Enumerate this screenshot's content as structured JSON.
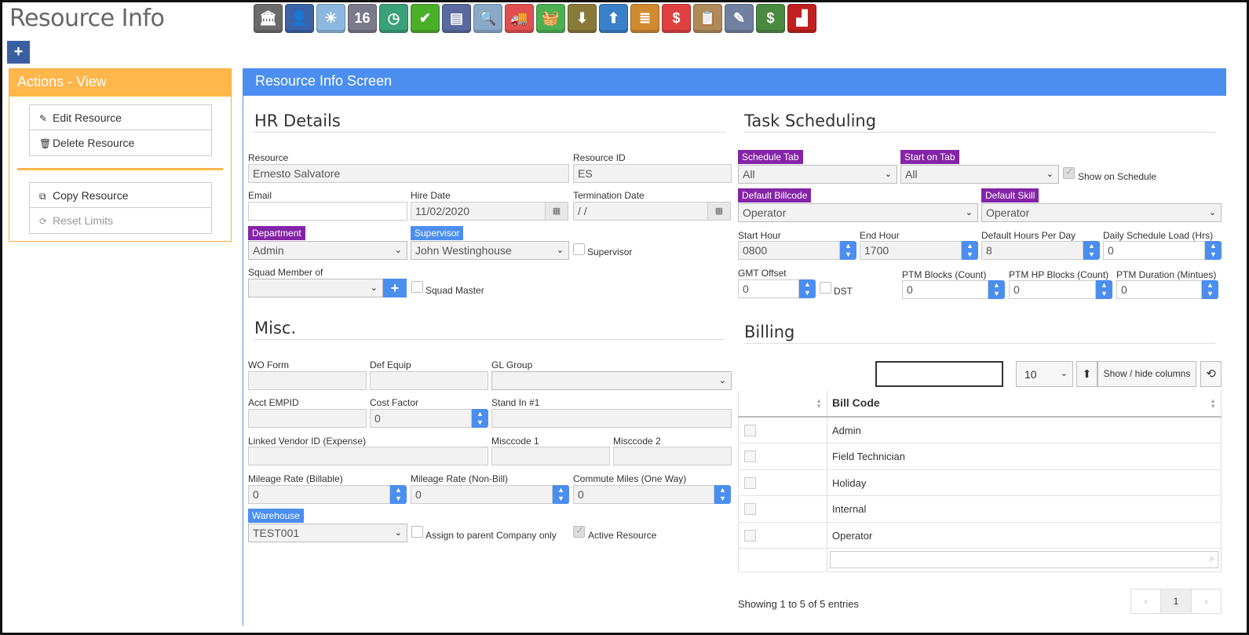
{
  "page": {
    "title": "Resource Info"
  },
  "toolbar": [
    {
      "icon": "bank-icon",
      "glyph": "🏛",
      "color": "#6b6b6b"
    },
    {
      "icon": "user-icon",
      "glyph": "👤",
      "color": "#3a63a8"
    },
    {
      "icon": "weather-icon",
      "glyph": "☀",
      "color": "#8cb8e0"
    },
    {
      "icon": "calendar-icon",
      "glyph": "16",
      "color": "#7a7a8a"
    },
    {
      "icon": "clock-icon",
      "glyph": "◷",
      "color": "#3aa07a"
    },
    {
      "icon": "checkmark-icon",
      "glyph": "✔",
      "color": "#4caf2a"
    },
    {
      "icon": "schedule-board-icon",
      "glyph": "▤",
      "color": "#5a6aa0"
    },
    {
      "icon": "magnifier-icon",
      "glyph": "🔍",
      "color": "#8aa8c8"
    },
    {
      "icon": "truck-icon",
      "glyph": "🚚",
      "color": "#e05050"
    },
    {
      "icon": "basket-icon",
      "glyph": "🧺",
      "color": "#4caf50"
    },
    {
      "icon": "inbox-download-icon",
      "glyph": "⬇",
      "color": "#8a7a3a"
    },
    {
      "icon": "outbox-upload-icon",
      "glyph": "⬆",
      "color": "#3a80c8"
    },
    {
      "icon": "stack-icon",
      "glyph": "≣",
      "color": "#d08a30"
    },
    {
      "icon": "money-chat-icon",
      "glyph": "$",
      "color": "#e04040"
    },
    {
      "icon": "clipboard-icon",
      "glyph": "📋",
      "color": "#b08a5a"
    },
    {
      "icon": "pencil-note-icon",
      "glyph": "✎",
      "color": "#7080a0"
    },
    {
      "icon": "cash-icon",
      "glyph": "$",
      "color": "#4a8a40"
    },
    {
      "icon": "factory-icon",
      "glyph": "▟",
      "color": "#c02020"
    }
  ],
  "actions": {
    "title": "Actions - View",
    "group1": [
      {
        "icon": "pencil-icon",
        "glyph": "✎",
        "label": "Edit Resource"
      },
      {
        "icon": "trash-icon",
        "glyph": "🗑",
        "label": "Delete Resource"
      }
    ],
    "group2": [
      {
        "icon": "copy-icon",
        "glyph": "⧉",
        "label": "Copy Resource"
      },
      {
        "icon": "refresh-icon",
        "glyph": "⟳",
        "label": "Reset Limits"
      }
    ]
  },
  "main": {
    "title": "Resource Info Screen"
  },
  "hr": {
    "title": "HR Details",
    "resource_label": "Resource",
    "resource_value": "Ernesto Salvatore",
    "resource_id_label": "Resource ID",
    "resource_id_value": "ES",
    "email_label": "Email",
    "email_value": "",
    "hire_date_label": "Hire Date",
    "hire_date_value": "11/02/2020",
    "termination_label": "Termination Date",
    "termination_value": " /  /",
    "department_label": "Department",
    "department_value": "Admin",
    "supervisor_label": "Supervisor",
    "supervisor_value": "John Westinghouse",
    "supervisor_check_label": "Supervisor",
    "squad_label": "Squad Member of",
    "squad_value": "",
    "squad_master_label": "Squad Master"
  },
  "misc": {
    "title": "Misc.",
    "wo_form_label": "WO Form",
    "def_equip_label": "Def Equip",
    "gl_group_label": "GL Group",
    "acct_empid_label": "Acct EMPID",
    "cost_factor_label": "Cost Factor",
    "cost_factor_value": "0",
    "stand_in_label": "Stand In #1",
    "linked_vendor_label": "Linked Vendor ID (Expense)",
    "misccode1_label": "Misccode 1",
    "misccode2_label": "Misccode 2",
    "mileage_billable_label": "Mileage Rate (Billable)",
    "mileage_billable_value": "0",
    "mileage_nonbill_label": "Mileage Rate (Non-Bill)",
    "mileage_nonbill_value": "0",
    "commute_label": "Commute Miles (One Way)",
    "commute_value": "0",
    "warehouse_label": "Warehouse",
    "warehouse_value": "TEST001",
    "assign_parent_label": "Assign to parent Company only",
    "active_resource_label": "Active Resource"
  },
  "task": {
    "title": "Task Scheduling",
    "schedule_tab_label": "Schedule Tab",
    "schedule_tab_value": "All",
    "start_tab_label": "Start on Tab",
    "start_tab_value": "All",
    "show_on_schedule_label": "Show on Schedule",
    "default_billcode_label": "Default Billcode",
    "default_billcode_value": "Operator",
    "default_skill_label": "Default Skill",
    "default_skill_value": "Operator",
    "start_hour_label": "Start Hour",
    "start_hour_value": "0800",
    "end_hour_label": "End Hour",
    "end_hour_value": "1700",
    "default_hours_label": "Default Hours Per Day",
    "default_hours_value": "8",
    "daily_load_label": "Daily Schedule Load (Hrs)",
    "daily_load_value": "0",
    "gmt_label": "GMT Offset",
    "gmt_value": "0",
    "dst_label": "DST",
    "ptm_blocks_label": "PTM Blocks (Count)",
    "ptm_blocks_value": "0",
    "ptm_hp_label": "PTM HP Blocks (Count)",
    "ptm_hp_value": "0",
    "ptm_duration_label": "PTM Duration (Mintues)",
    "ptm_duration_value": "0"
  },
  "billing": {
    "title": "Billing",
    "page_size": "10",
    "show_hide_label": "Show / hide columns",
    "column_header": "Bill Code",
    "rows": [
      "Admin",
      "Field Technician",
      "Holiday",
      "Internal",
      "Operator"
    ],
    "showing_text": "Showing 1 to 5 of 5 entries",
    "pager_prev": "‹",
    "pager_current": "1",
    "pager_next": "›"
  }
}
